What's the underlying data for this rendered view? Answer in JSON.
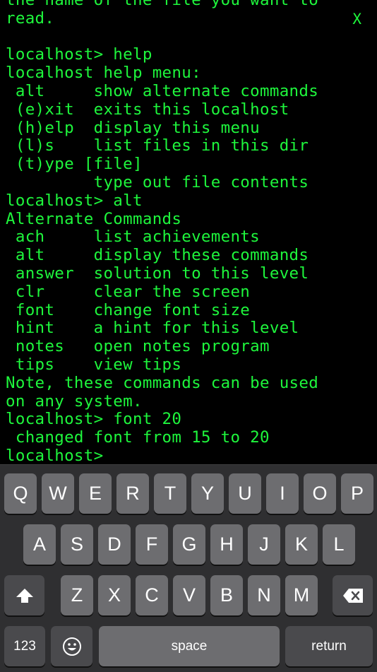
{
  "terminal": {
    "close_label": "X",
    "lines": [
      "the name of the file you want to",
      "read.",
      "",
      "localhost> help",
      "localhost help menu:",
      " alt     show alternate commands",
      " (e)xit  exits this localhost",
      " (h)elp  display this menu",
      " (l)s    list files in this dir",
      " (t)ype [file]",
      "         type out file contents",
      "localhost> alt",
      "Alternate Commands",
      " ach     list achievements",
      " alt     display these commands",
      " answer  solution to this level",
      " clr     clear the screen",
      " font    change font size",
      " hint    a hint for this level",
      " notes   open notes program",
      " tips    view tips",
      "Note, these commands can be used",
      "on any system.",
      "localhost> font 20",
      " changed font from 15 to 20",
      "localhost>"
    ]
  },
  "keyboard": {
    "row1": [
      "Q",
      "W",
      "E",
      "R",
      "T",
      "Y",
      "U",
      "I",
      "O",
      "P"
    ],
    "row2": [
      "A",
      "S",
      "D",
      "F",
      "G",
      "H",
      "J",
      "K",
      "L"
    ],
    "row3": [
      "Z",
      "X",
      "C",
      "V",
      "B",
      "N",
      "M"
    ],
    "numbers_label": "123",
    "space_label": "space",
    "return_label": "return",
    "shift_icon": "shift-arrow-icon",
    "delete_icon": "backspace-icon",
    "emoji_icon": "emoji-icon"
  },
  "colors": {
    "terminal_text": "#1ef63c",
    "terminal_bg": "#000000",
    "keyboard_bg": "#2f2f31",
    "key_bg": "#6d6d70",
    "key_dark_bg": "#4a4a4d"
  }
}
